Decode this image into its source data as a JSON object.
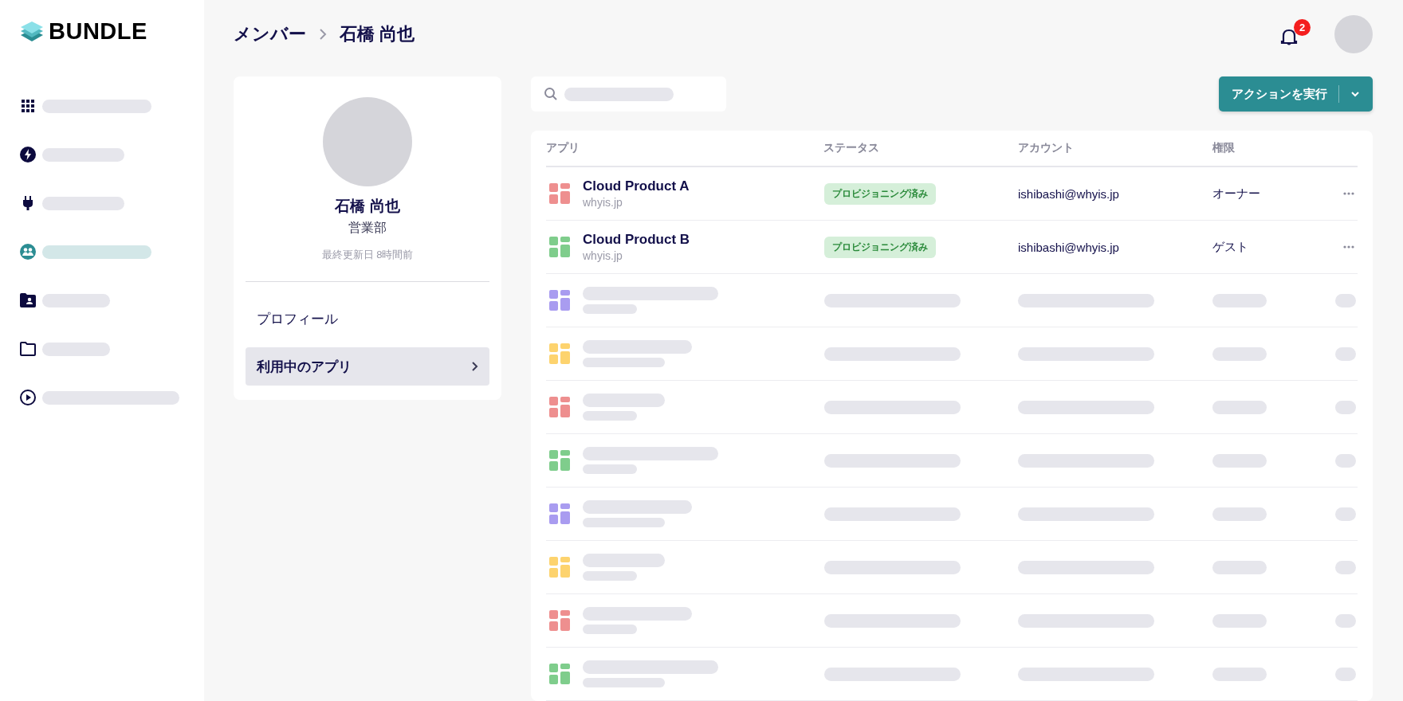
{
  "logo": {
    "text": "BUNDLE"
  },
  "sidebar": {
    "items": [
      {
        "selected": false
      },
      {
        "selected": false
      },
      {
        "selected": false
      },
      {
        "selected": true
      },
      {
        "selected": false
      },
      {
        "selected": false
      },
      {
        "selected": false
      }
    ]
  },
  "breadcrumb": [
    "メンバー",
    "石橋 尚也"
  ],
  "notifications": {
    "count": "2"
  },
  "profile": {
    "name": "石橋 尚也",
    "department": "営業部",
    "updated": "最終更新日 8時間前",
    "menu": [
      {
        "label": "プロフィール",
        "selected": false
      },
      {
        "label": "利用中のアプリ",
        "selected": true
      }
    ]
  },
  "action_button": {
    "label": "アクションを実行"
  },
  "table": {
    "columns": [
      "アプリ",
      "ステータス",
      "アカウント",
      "権限"
    ],
    "rows": [
      {
        "kind": "app",
        "color": "#ee8f8f",
        "name": "Cloud Product A",
        "domain": "whyis.jp",
        "status": "プロビジョニング済み",
        "account": "ishibashi@whyis.jp",
        "role": "オーナー"
      },
      {
        "kind": "app",
        "color": "#7fcd8c",
        "name": "Cloud Product B",
        "domain": "whyis.jp",
        "status": "プロビジョニング済み",
        "account": "ishibashi@whyis.jp",
        "role": "ゲスト"
      },
      {
        "kind": "skeleton",
        "color": "#a99cf0"
      },
      {
        "kind": "skeleton",
        "color": "#fdd36e"
      },
      {
        "kind": "skeleton",
        "color": "#ee8f8f"
      },
      {
        "kind": "skeleton",
        "color": "#7fcd8c"
      },
      {
        "kind": "skeleton",
        "color": "#a99cf0"
      },
      {
        "kind": "skeleton",
        "color": "#fdd36e"
      },
      {
        "kind": "skeleton",
        "color": "#ee8f8f"
      },
      {
        "kind": "skeleton",
        "color": "#7fcd8c"
      }
    ]
  }
}
